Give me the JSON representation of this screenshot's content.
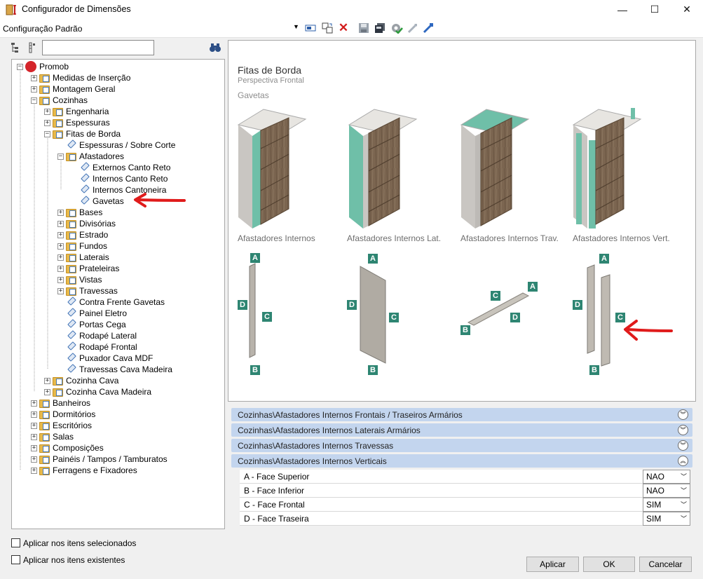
{
  "window": {
    "title": "Configurador de Dimensões",
    "minimize": "—",
    "maximize": "☐",
    "close": "✕"
  },
  "toolbar": {
    "config_name": "Configuração Padrão"
  },
  "tree": {
    "root": "Promob",
    "items": [
      "Medidas de Inserção",
      "Montagem Geral",
      "Cozinhas",
      "Engenharia",
      "Espessuras",
      "Fitas de Borda",
      "Espessuras / Sobre Corte",
      "Afastadores",
      "Externos Canto Reto",
      "Internos Canto Reto",
      "Internos Cantoneira",
      "Gavetas",
      "Bases",
      "Divisórias",
      "Estrado",
      "Fundos",
      "Laterais",
      "Prateleiras",
      "Vistas",
      "Travessas",
      "Contra Frente Gavetas",
      "Painel Eletro",
      "Portas Cega",
      "Rodapé Lateral",
      "Rodapé Frontal",
      "Puxador Cava MDF",
      "Travessas Cava Madeira",
      "Cozinha Cava",
      "Cozinha Cava Madeira",
      "Banheiros",
      "Dormitórios",
      "Escritórios",
      "Salas",
      "Composições",
      "Painéis / Tampos / Tamburatos",
      "Ferragens e Fixadores"
    ]
  },
  "options": {
    "apply_selected": "Aplicar nos itens selecionados",
    "apply_existing": "Aplicar nos itens existentes"
  },
  "preview": {
    "title": "Fitas de Borda",
    "subtitle": "Perspectiva Frontal",
    "group": "Gavetas",
    "captions": [
      "Afastadores Internos",
      "Afastadores Internos Lat.",
      "Afastadores Internos Trav.",
      "Afastadores Internos Vert."
    ],
    "letters": {
      "a": "A",
      "b": "B",
      "c": "C",
      "d": "D"
    }
  },
  "sections": [
    "Cozinhas\\Afastadores Internos Frontais / Traseiros Armários",
    "Cozinhas\\Afastadores Internos Laterais Armários",
    "Cozinhas\\Afastadores Internos Travessas",
    "Cozinhas\\Afastadores Internos Verticais"
  ],
  "properties": [
    {
      "label": "A - Face Superior",
      "value": "NAO"
    },
    {
      "label": "B - Face Inferior",
      "value": "NAO"
    },
    {
      "label": "C - Face Frontal",
      "value": "SIM"
    },
    {
      "label": "D - Face Traseira",
      "value": "SIM"
    }
  ],
  "buttons": {
    "apply": "Aplicar",
    "ok": "OK",
    "cancel": "Cancelar"
  },
  "colors": {
    "accent_letter": "#2e8572",
    "section_header": "#c3d5ee",
    "arrow": "#e01b1b"
  }
}
